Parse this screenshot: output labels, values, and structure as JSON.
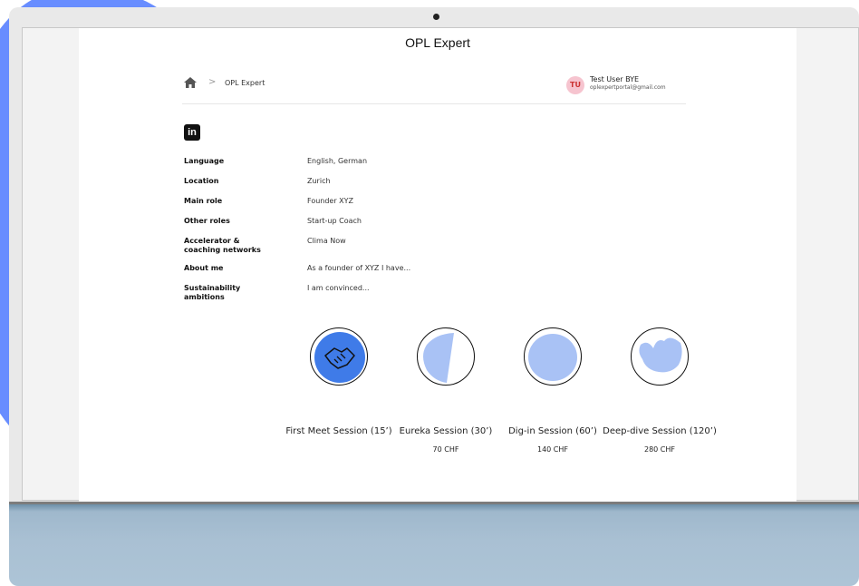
{
  "window": {
    "title": "OPL Expert"
  },
  "breadcrumb": {
    "home_icon": "home-icon",
    "separator": ">",
    "current": "OPL Expert"
  },
  "user": {
    "initials": "TU",
    "name": "Test User BYE",
    "email": "oplexpertportal@gmail.com"
  },
  "profile": {
    "linkedin_label": "in",
    "fields": [
      {
        "label": "Language",
        "value": "English, German"
      },
      {
        "label": "Location",
        "value": "Zurich"
      },
      {
        "label": "Main role",
        "value": "Founder XYZ"
      },
      {
        "label": "Other roles",
        "value": "Start-up Coach"
      },
      {
        "label": "Accelerator & coaching networks",
        "value": "Clima Now"
      },
      {
        "label": "About me",
        "value": "As a founder of XYZ I have..."
      },
      {
        "label": "Sustainability ambitions",
        "value": "I am convinced..."
      }
    ]
  },
  "sessions": [
    {
      "name": "First Meet Session (15’)",
      "price": "",
      "icon": "handshake-icon"
    },
    {
      "name": "Eureka Session (30’)",
      "price": "70 CHF",
      "icon": "slice-icon"
    },
    {
      "name": "Dig-in Session (60’)",
      "price": "140 CHF",
      "icon": "full-circle-icon"
    },
    {
      "name": "Deep-dive Session (120’)",
      "price": "280 CHF",
      "icon": "wave-icon"
    }
  ],
  "colors": {
    "accent": "#4d79ff",
    "session_fill": "#a9c2f5",
    "handshake_fill": "#3f7be8"
  }
}
